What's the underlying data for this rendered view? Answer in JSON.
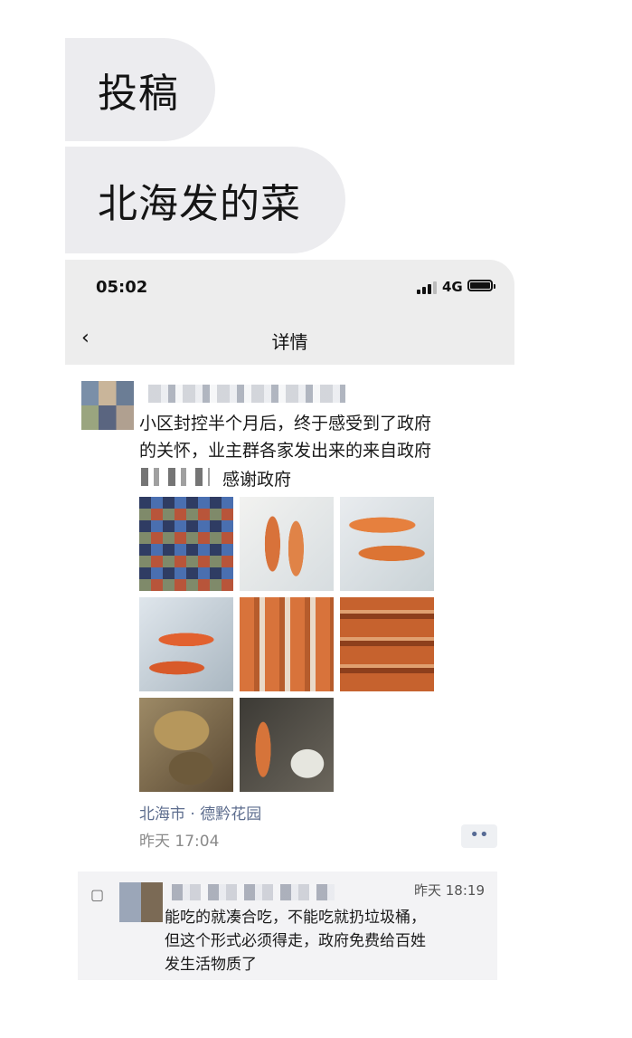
{
  "messages": [
    {
      "text": "投稿"
    },
    {
      "text": "北海发的菜"
    }
  ],
  "phone": {
    "status_bar": {
      "time": "05:02",
      "network": "4G"
    },
    "nav": {
      "back_icon": "chevron-left-icon",
      "title": "详情"
    },
    "post": {
      "text_lines": [
        "小区封控半个月后，终于感受到了政府",
        "的关怀，业主群各家发出来的来自政府",
        "感谢政府"
      ],
      "images": [
        "carrot",
        "carrot",
        "carrot",
        "carrot",
        "carrot",
        "carrot",
        "potato",
        "carrot"
      ],
      "location": "北海市 · 德黔花园",
      "time": "昨天 17:04",
      "more_label": "••"
    },
    "comment": {
      "icon": "comment-icon",
      "time": "昨天 18:19",
      "lines": [
        "能吃的就凑合吃，不能吃就扔垃圾桶，",
        "但这个形式必须得走，政府免费给百姓",
        "发生活物质了"
      ]
    }
  }
}
